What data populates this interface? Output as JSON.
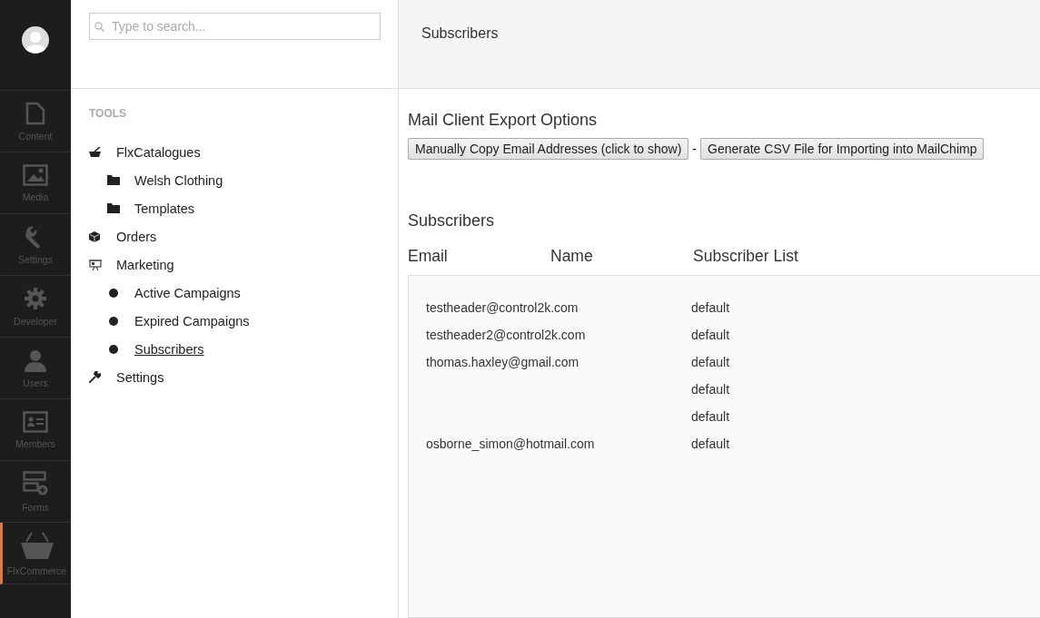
{
  "nav": [
    {
      "kind": "content",
      "label": "Content",
      "selected": false
    },
    {
      "kind": "media",
      "label": "Media",
      "selected": false
    },
    {
      "kind": "settings",
      "label": "Settings",
      "selected": false
    },
    {
      "kind": "developer",
      "label": "Developer",
      "selected": false
    },
    {
      "kind": "users",
      "label": "Users",
      "selected": false
    },
    {
      "kind": "members",
      "label": "Members",
      "selected": false
    },
    {
      "kind": "forms",
      "label": "Forms",
      "selected": false
    },
    {
      "kind": "commerce",
      "label": "FlxCommerce",
      "selected": true
    }
  ],
  "search": {
    "placeholder": "Type to search..."
  },
  "tree": {
    "heading": "TOOLS",
    "items": [
      {
        "kind": "catalogue",
        "label": "FlxCatalogues",
        "selected": false,
        "children": [
          {
            "kind": "folder",
            "label": "Welsh Clothing",
            "selected": false
          },
          {
            "kind": "folder",
            "label": "Templates",
            "selected": false
          }
        ]
      },
      {
        "kind": "box",
        "label": "Orders",
        "selected": false
      },
      {
        "kind": "marketing",
        "label": "Marketing",
        "selected": false,
        "children": [
          {
            "kind": "dot",
            "label": "Active Campaigns",
            "selected": false
          },
          {
            "kind": "dot",
            "label": "Expired Campaigns",
            "selected": false
          },
          {
            "kind": "dot",
            "label": "Subscribers",
            "selected": true
          }
        ]
      },
      {
        "kind": "wrench",
        "label": "Settings",
        "selected": false
      }
    ]
  },
  "header": {
    "title": "Subscribers"
  },
  "export": {
    "heading": "Mail Client Export Options",
    "buttons": [
      "Manually Copy Email Addresses (click to show)",
      "Generate CSV File for Importing into MailChimp"
    ],
    "separator": "-"
  },
  "subscribers": {
    "heading": "Subscribers",
    "columns": [
      "Email",
      "Name",
      "Subscriber List"
    ],
    "rows": [
      {
        "email": "testheader@control2k.com",
        "list": "default"
      },
      {
        "email": "testheader2@control2k.com",
        "list": "default"
      },
      {
        "email": "thomas.haxley@gmail.com",
        "list": "default"
      },
      {
        "list": "default"
      },
      {
        "list": "default"
      },
      {
        "email": "osborne_simon@hotmail.com",
        "list": "default"
      }
    ]
  }
}
